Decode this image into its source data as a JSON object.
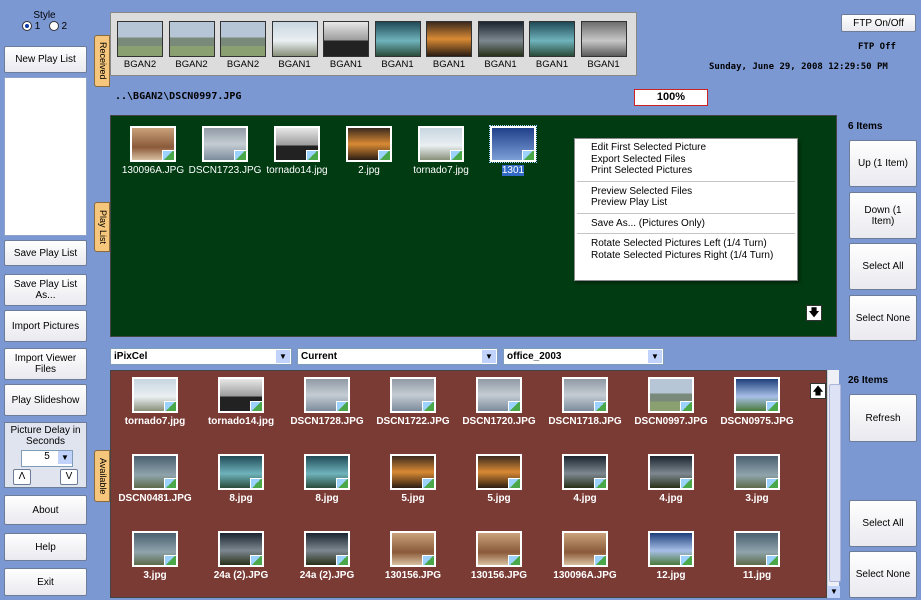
{
  "left": {
    "style_label": "Style",
    "style_options": [
      "1",
      "2"
    ],
    "new_play_list": "New Play List",
    "save_play_list": "Save Play List",
    "save_play_list_as": "Save Play List As...",
    "import_pictures": "Import Pictures",
    "import_viewer_files": "Import Viewer Files",
    "play_slideshow": "Play Slideshow",
    "delay_label": "Picture Delay in Seconds",
    "delay_value": "5",
    "delay_up": "Λ",
    "delay_down": "V",
    "about": "About",
    "help": "Help",
    "exit": "Exit"
  },
  "tabs": {
    "received": "Received",
    "play_list": "Play List",
    "available": "Available"
  },
  "received": {
    "thumbs": [
      {
        "label": "BGAN2",
        "img": "g-house"
      },
      {
        "label": "BGAN2",
        "img": "g-house"
      },
      {
        "label": "BGAN2",
        "img": "g-house"
      },
      {
        "label": "BGAN1",
        "img": "g-pale"
      },
      {
        "label": "BGAN1",
        "img": "g-tornado"
      },
      {
        "label": "BGAN1",
        "img": "g-teal"
      },
      {
        "label": "BGAN1",
        "img": "g-sunset"
      },
      {
        "label": "BGAN1",
        "img": "g-dark"
      },
      {
        "label": "BGAN1",
        "img": "g-teal"
      },
      {
        "label": "BGAN1",
        "img": "g-grey"
      }
    ]
  },
  "path": "..\\BGAN2\\DSCN0997.JPG",
  "zoom": "100%",
  "ftp": {
    "button": "FTP On/Off",
    "status": "FTP Off",
    "datetime": "Sunday, June 29, 2008  12:29:50 PM"
  },
  "playlist": {
    "count": "6 Items",
    "items": [
      {
        "name": "130096A.JPG",
        "img": "g-people"
      },
      {
        "name": "DSCN1723.JPG",
        "img": "g-aerial"
      },
      {
        "name": "tornado14.jpg",
        "img": "g-tornado"
      },
      {
        "name": "2.jpg",
        "img": "g-sunset"
      },
      {
        "name": "tornado7.jpg",
        "img": "g-pale"
      },
      {
        "name": "1301",
        "img": "g-blue",
        "selected": true
      }
    ]
  },
  "context_menu": {
    "items": [
      "Edit First Selected Picture",
      "Export Selected Files",
      "Print Selected Pictures",
      "---",
      "Preview Selected Files",
      "Preview Play List",
      "---",
      "Save As... (Pictures Only)",
      "---",
      "Rotate Selected Pictures Left (1/4 Turn)",
      "Rotate Selected Pictures Right (1/4 Turn)"
    ]
  },
  "right": {
    "up": "Up (1 Item)",
    "down": "Down (1 Item)",
    "select_all": "Select All",
    "select_none": "Select None",
    "refresh": "Refresh",
    "select_all_2": "Select All",
    "select_none_2": "Select None"
  },
  "filters": {
    "source": "iPixCel",
    "scope": "Current",
    "theme": "office_2003"
  },
  "available": {
    "count": "26 Items",
    "rows": [
      [
        {
          "name": "tornado7.jpg",
          "img": "g-pale"
        },
        {
          "name": "tornado14.jpg",
          "img": "g-tornado"
        },
        {
          "name": "DSCN1728.JPG",
          "img": "g-aerial"
        },
        {
          "name": "DSCN1722.JPG",
          "img": "g-aerial"
        },
        {
          "name": "DSCN1720.JPG",
          "img": "g-aerial"
        },
        {
          "name": "DSCN1718.JPG",
          "img": "g-aerial"
        },
        {
          "name": "DSCN0997.JPG",
          "img": "g-house"
        },
        {
          "name": "DSCN0975.JPG",
          "img": "g-sky"
        }
      ],
      [
        {
          "name": "DSCN0481.JPG",
          "img": "g-storm"
        },
        {
          "name": "8.jpg",
          "img": "g-teal"
        },
        {
          "name": "8.jpg",
          "img": "g-teal"
        },
        {
          "name": "5.jpg",
          "img": "g-sunset"
        },
        {
          "name": "5.jpg",
          "img": "g-sunset"
        },
        {
          "name": "4.jpg",
          "img": "g-dark"
        },
        {
          "name": "4.jpg",
          "img": "g-dark"
        },
        {
          "name": "3.jpg",
          "img": "g-storm"
        }
      ],
      [
        {
          "name": "3.jpg",
          "img": "g-storm"
        },
        {
          "name": "24a (2).JPG",
          "img": "g-dark"
        },
        {
          "name": "24a (2).JPG",
          "img": "g-dark"
        },
        {
          "name": "130156.JPG",
          "img": "g-people"
        },
        {
          "name": "130156.JPG",
          "img": "g-people"
        },
        {
          "name": "130096A.JPG",
          "img": "g-people"
        },
        {
          "name": "12.jpg",
          "img": "g-sky"
        },
        {
          "name": "11.jpg",
          "img": "g-storm"
        }
      ]
    ]
  }
}
